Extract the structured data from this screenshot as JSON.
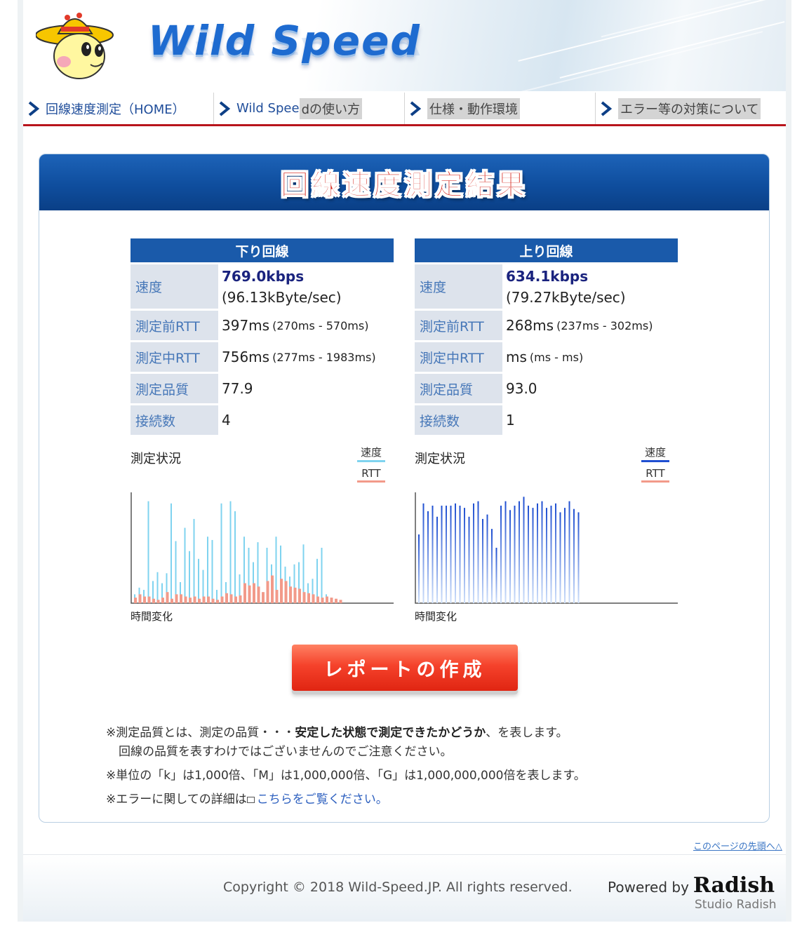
{
  "header": {
    "logo_text": "Wild Speed"
  },
  "nav": {
    "items": [
      {
        "label": "回線速度測定（HOME）",
        "highlight": ""
      },
      {
        "label": "Wild Spee",
        "highlight": "dの使い方"
      },
      {
        "label": "",
        "highlight": "仕様・動作環境"
      },
      {
        "label": "",
        "highlight": "エラー等の対策について"
      }
    ]
  },
  "panel": {
    "title": "回線速度測定結果"
  },
  "download": {
    "title": "下り回線",
    "speed_label": "速度",
    "speed": "769.0kbps",
    "speed_bytes": "(96.13kByte/sec)",
    "rtt_before_label": "測定前RTT",
    "rtt_before": "397ms",
    "rtt_before_range": "(270ms - 570ms)",
    "rtt_during_label": "測定中RTT",
    "rtt_during": "756ms",
    "rtt_during_range": "(277ms - 1983ms)",
    "quality_label": "測定品質",
    "quality": "77.9",
    "connections_label": "接続数",
    "connections": "4"
  },
  "upload": {
    "title": "上り回線",
    "speed_label": "速度",
    "speed": "634.1kbps",
    "speed_bytes": "(79.27kByte/sec)",
    "rtt_before_label": "測定前RTT",
    "rtt_before": "268ms",
    "rtt_before_range": "(237ms - 302ms)",
    "rtt_during_label": "測定中RTT",
    "rtt_during": "ms",
    "rtt_during_range": "(ms - ms)",
    "quality_label": "測定品質",
    "quality": "93.0",
    "connections_label": "接続数",
    "connections": "1"
  },
  "status": {
    "title": "測定状況",
    "legend_speed": "速度",
    "legend_rtt": "RTT",
    "xlabel": "時間変化"
  },
  "colors": {
    "download_speed": "#7fd3ef",
    "download_rtt": "#f29a8a",
    "upload_speed": "#1f4fd1",
    "upload_rtt": "#f29a8a"
  },
  "chart_data": [
    {
      "type": "bar",
      "series": [
        {
          "values": [
            8,
            14,
            12,
            92,
            20,
            28,
            18,
            27,
            90,
            56,
            19,
            68,
            47,
            76,
            40,
            30,
            60,
            57,
            12,
            90,
            19,
            92,
            83,
            26,
            60,
            50,
            37,
            55,
            8,
            50,
            35,
            60,
            52,
            33,
            24,
            35,
            37,
            53,
            18,
            22,
            40,
            50,
            8,
            5,
            2,
            1
          ]
        },
        {
          "values": [
            5,
            8,
            6,
            6,
            4,
            3,
            5,
            10,
            4,
            8,
            8,
            6,
            5,
            6,
            4,
            6,
            6,
            4,
            3,
            6,
            9,
            8,
            6,
            7,
            18,
            16,
            18,
            15,
            10,
            20,
            25,
            12,
            22,
            20,
            15,
            14,
            13,
            10,
            9,
            8,
            6,
            5,
            6,
            5,
            4,
            3
          ]
        }
      ]
    },
    {
      "type": "bar",
      "series": [
        {
          "values": [
            62,
            90,
            83,
            88,
            78,
            88,
            88,
            88,
            90,
            88,
            86,
            78,
            90,
            92,
            76,
            80,
            67,
            50,
            88,
            92,
            84,
            88,
            92,
            96,
            88,
            86,
            90,
            92,
            86,
            88,
            90,
            82,
            86,
            92,
            85,
            82
          ]
        }
      ]
    }
  ],
  "report_button": {
    "label": "レポートの作成"
  },
  "notes": {
    "quality_prefix": "※測定品質とは、測定の品質・・・",
    "quality_bold": "安定した状態で測定できたかどうか",
    "quality_suffix": "、を表します。",
    "quality_line2": "回線の品質を表すわけではございませんのでご注意ください。",
    "units": "※単位の「k」は1,000倍、「M」は1,000,000倍、「G」は1,000,000,000倍を表します。",
    "error_prefix": "※エラーに関しての詳細は",
    "error_link": "こちらをご覧ください。"
  },
  "footer": {
    "to_top": "このページの先頭へ△",
    "copyright": "Copyright © 2018 Wild-Speed.JP. All rights reserved.",
    "powered_by": "Powered by",
    "brand": "Radish",
    "studio": "Studio Radish"
  }
}
